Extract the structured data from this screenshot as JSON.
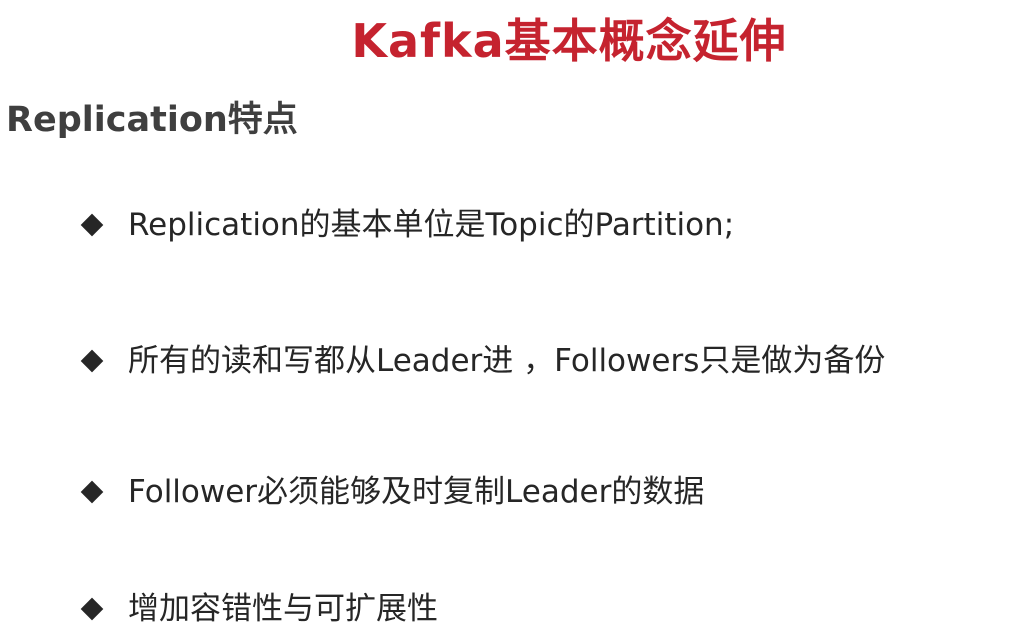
{
  "slide": {
    "title": "Kafka基本概念延伸",
    "subtitle": "Replication特点",
    "bullets": [
      {
        "text": "Replication的基本单位是Topic的Partition;"
      },
      {
        "text": "所有的读和写都从Leader进 ，Followers只是做为备份"
      },
      {
        "text": "Follower必须能够及时复制Leader的数据"
      },
      {
        "text": "增加容错性与可扩展性"
      }
    ],
    "bullet_icon": "diamond-bullet-icon"
  },
  "colors": {
    "title": "#c5232f",
    "subtitle": "#3f3f3f",
    "bullet_text": "#262626",
    "bullet_icon": "#262626",
    "background": "#ffffff"
  }
}
